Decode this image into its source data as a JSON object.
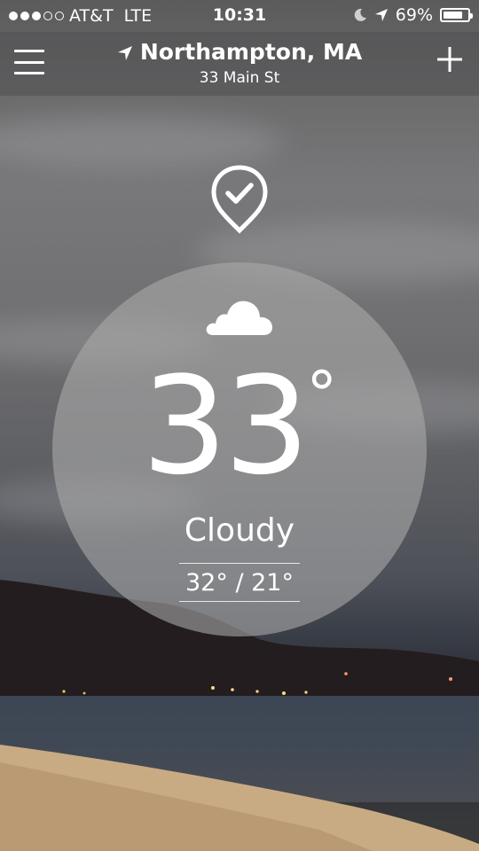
{
  "status_bar": {
    "carrier": "AT&T",
    "network": "LTE",
    "time": "10:31",
    "battery_percent": "69%",
    "signal_bars_filled": 3,
    "signal_bars_total": 5
  },
  "header": {
    "city": "Northampton, MA",
    "street": "33 Main St"
  },
  "weather": {
    "temperature": "33",
    "degree_symbol": "°",
    "condition": "Cloudy",
    "high_low": "32° / 21°"
  },
  "icons": {
    "menu": "hamburger-icon",
    "add": "plus-icon",
    "location_arrow": "location-arrow-icon",
    "location_pin": "location-check-pin-icon",
    "weather": "cloud-icon",
    "moon": "moon-icon"
  },
  "colors": {
    "circle_fill": "#aaaaaa",
    "text": "#ffffff"
  }
}
